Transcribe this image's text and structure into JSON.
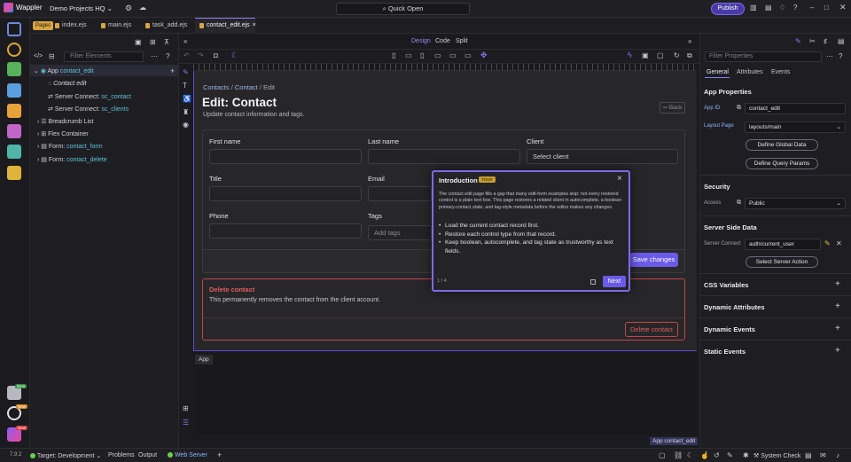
{
  "app": {
    "name": "Wappler",
    "project": "Demo Projects HQ",
    "quick_open": "Quick Open",
    "publish": "Publish"
  },
  "tabs": {
    "pages_badge": "Pages",
    "files": [
      "index.ejs",
      "main.ejs",
      "task_add.ejs",
      "contact_edit.ejs"
    ],
    "close": "×"
  },
  "structure": {
    "filter_placeholder": "Filter Elements",
    "tree": [
      {
        "prefix": "App",
        "key": "contact_edit"
      },
      {
        "prefix": "",
        "key": "Contact edit"
      },
      {
        "prefix": "Server Connect:",
        "key": "sc_contact"
      },
      {
        "prefix": "Server Connect:",
        "key": "sc_clients"
      },
      {
        "prefix": "Breadcrumb List",
        "key": ""
      },
      {
        "prefix": "Flex Container",
        "key": ""
      },
      {
        "prefix": "Form:",
        "key": "contact_form"
      },
      {
        "prefix": "Form:",
        "key": "contact_delete"
      }
    ]
  },
  "center": {
    "view_modes": [
      "Design",
      "Code",
      "Split"
    ],
    "app_label": "App",
    "bottom_selection": "App contact_edit"
  },
  "form": {
    "breadcrumb": [
      "Contacts",
      "Contact",
      "Edit"
    ],
    "title": "Edit: Contact",
    "subtitle": "Update contact information and tags.",
    "back": "Back",
    "labels": {
      "first_name": "First name",
      "last_name": "Last name",
      "client": "Client",
      "title": "Title",
      "email": "Email",
      "phone": "Phone",
      "tags": "Tags"
    },
    "client_placeholder": "Select client",
    "tags_placeholder": "Add tags",
    "save": "Save changes",
    "delete_title": "Delete contact",
    "delete_text": "This permanently removes the contact from the client account.",
    "delete_button": "Delete contact"
  },
  "tour": {
    "title": "Introduction",
    "badge": "TOUR",
    "body": "The contact edit page fills a gap that many edit-form examples skip: not every restored control is a plain text box. This page restores a related client in autocomplete, a boolean primary-contact state, and tag-style metadata before the editor makes any changes.",
    "steps": [
      "Load the current contact record first.",
      "Restore each control type from that record.",
      "Keep boolean, autocomplete, and tag state as trustworthy as text fields."
    ],
    "step_count": "1 / 4",
    "next": "Next"
  },
  "properties": {
    "filter_placeholder": "Filter Properties",
    "tabs": [
      "General",
      "Attributes",
      "Events"
    ],
    "app_properties": "App Properties",
    "app_id_label": "App ID",
    "app_id": "contact_edit",
    "layout_label": "Layout Page",
    "layout": "layouts/main",
    "define_global": "Define Global Data",
    "define_query": "Define Query Params",
    "security": "Security",
    "access_label": "Access",
    "access": "Public",
    "server_side": "Server Side Data",
    "server_connect_label": "Server Connect",
    "server_connect": "auth/current_user",
    "select_action": "Select Server Action",
    "sections": [
      "CSS Variables",
      "Dynamic Attributes",
      "Dynamic Events",
      "Static Events"
    ]
  },
  "status": {
    "version": "7.9.2",
    "target_label": "Target:",
    "target": "Development",
    "problems": "Problems",
    "output": "Output",
    "web_server": "Web Server",
    "system_check": "System Check",
    "badge_beta": "Beta",
    "badge_new": "New"
  }
}
